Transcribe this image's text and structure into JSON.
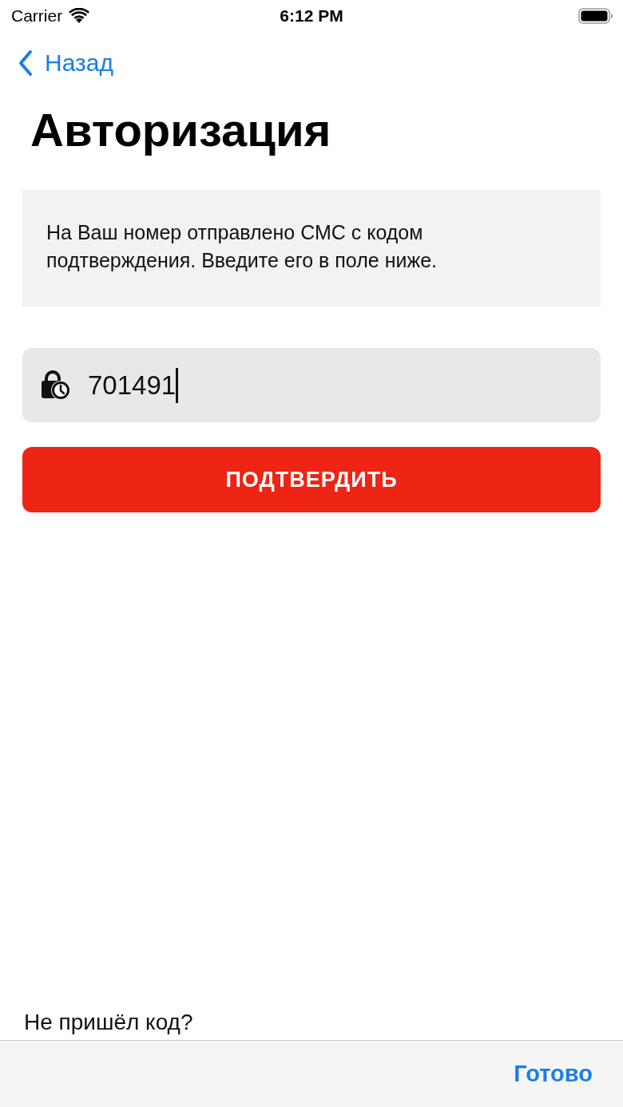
{
  "status_bar": {
    "carrier": "Carrier",
    "time": "6:12 PM"
  },
  "nav": {
    "back": "Назад"
  },
  "title": "Авторизация",
  "info": "На Ваш номер отправлено СМС с кодом подтверждения. Введите его в поле ниже.",
  "code_field": {
    "value": "701491",
    "focused": true
  },
  "confirm_button": "ПОДТВЕРДИТЬ",
  "resend_prompt": "Не пришёл код?",
  "keyboard_toolbar": {
    "done": "Готово"
  }
}
